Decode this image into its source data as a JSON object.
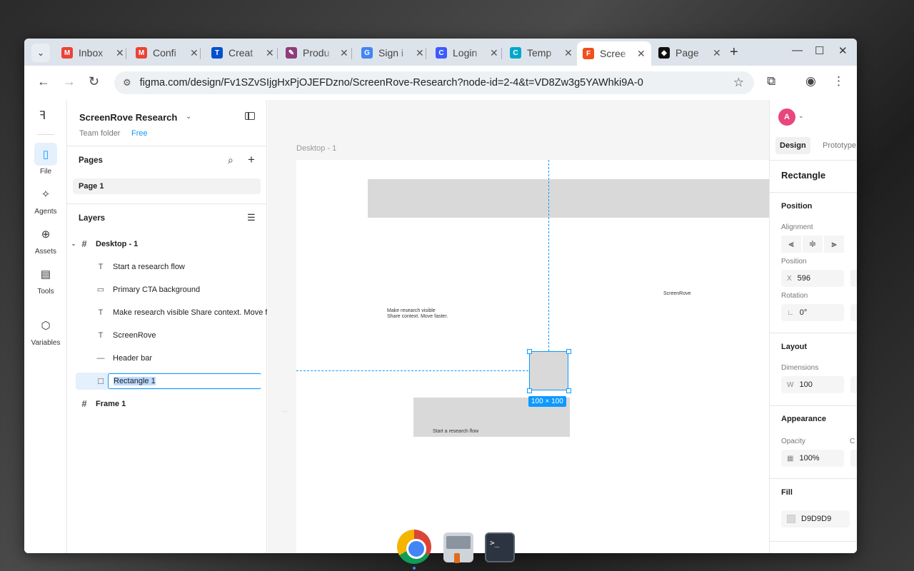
{
  "browser": {
    "tabs": [
      {
        "title": "Inbox",
        "fav": "M",
        "color": "#ea4335"
      },
      {
        "title": "Confi",
        "fav": "M",
        "color": "#ea4335"
      },
      {
        "title": "Creat",
        "fav": "T",
        "color": "#0052cc"
      },
      {
        "title": "Produ",
        "fav": "✎",
        "color": "#8e3c7a"
      },
      {
        "title": "Sign i",
        "fav": "G",
        "color": "#4285f4"
      },
      {
        "title": "Login",
        "fav": "C",
        "color": "#3d5afe"
      },
      {
        "title": "Temp",
        "fav": "C",
        "color": "#00a7cc"
      },
      {
        "title": "Scree",
        "fav": "F",
        "color": "#f24e1e"
      },
      {
        "title": "Page",
        "fav": "◆",
        "color": "#111111"
      }
    ],
    "url": "figma.com/design/Fv1SZvSIjgHxPjOJEFDzno/ScreenRove-Research?node-id=2-4&t=VD8Zw3g5YAWhki9A-0"
  },
  "rail": {
    "items": [
      {
        "label": "File",
        "icon": "file-icon"
      },
      {
        "label": "Agents",
        "icon": "sparkle-icon"
      },
      {
        "label": "Assets",
        "icon": "assets-icon"
      },
      {
        "label": "Tools",
        "icon": "toolbox-icon"
      },
      {
        "label": "Variables",
        "icon": "variables-icon"
      }
    ]
  },
  "left": {
    "project": "ScreenRove Research",
    "team": "Team folder",
    "plan": "Free",
    "pages_title": "Pages",
    "page": "Page 1",
    "layers_title": "Layers",
    "layers": [
      {
        "name": "Desktop - 1"
      },
      {
        "name": "Start a research flow"
      },
      {
        "name": "Primary CTA background"
      },
      {
        "name": "Make research visible Share context. Move faster."
      },
      {
        "name": "ScreenRove"
      },
      {
        "name": "Header bar"
      },
      {
        "name": "Rectangle 1"
      },
      {
        "name": "Frame 1"
      }
    ]
  },
  "canvas": {
    "frame_label": "Desktop - 1",
    "text_tagline_1": "Make research visible",
    "text_tagline_2": "Share context. Move faster.",
    "text_brand": "ScreenRove",
    "text_cta": "Start a research flow",
    "dim_badge": "100 × 100"
  },
  "right": {
    "avatar": "A",
    "tab_design": "Design",
    "tab_prototype": "Prototype",
    "title": "Rectangle",
    "position_title": "Position",
    "alignment_label": "Alignment",
    "position_label": "Position",
    "x_label": "X",
    "x_value": "596",
    "rotation_label": "Rotation",
    "rotation_value": "0°",
    "layout_title": "Layout",
    "dimensions_label": "Dimensions",
    "w_label": "W",
    "w_value": "100",
    "appearance_title": "Appearance",
    "opacity_label": "Opacity",
    "opacity_value": "100%",
    "fill_title": "Fill",
    "fill_value": "D9D9D9"
  }
}
